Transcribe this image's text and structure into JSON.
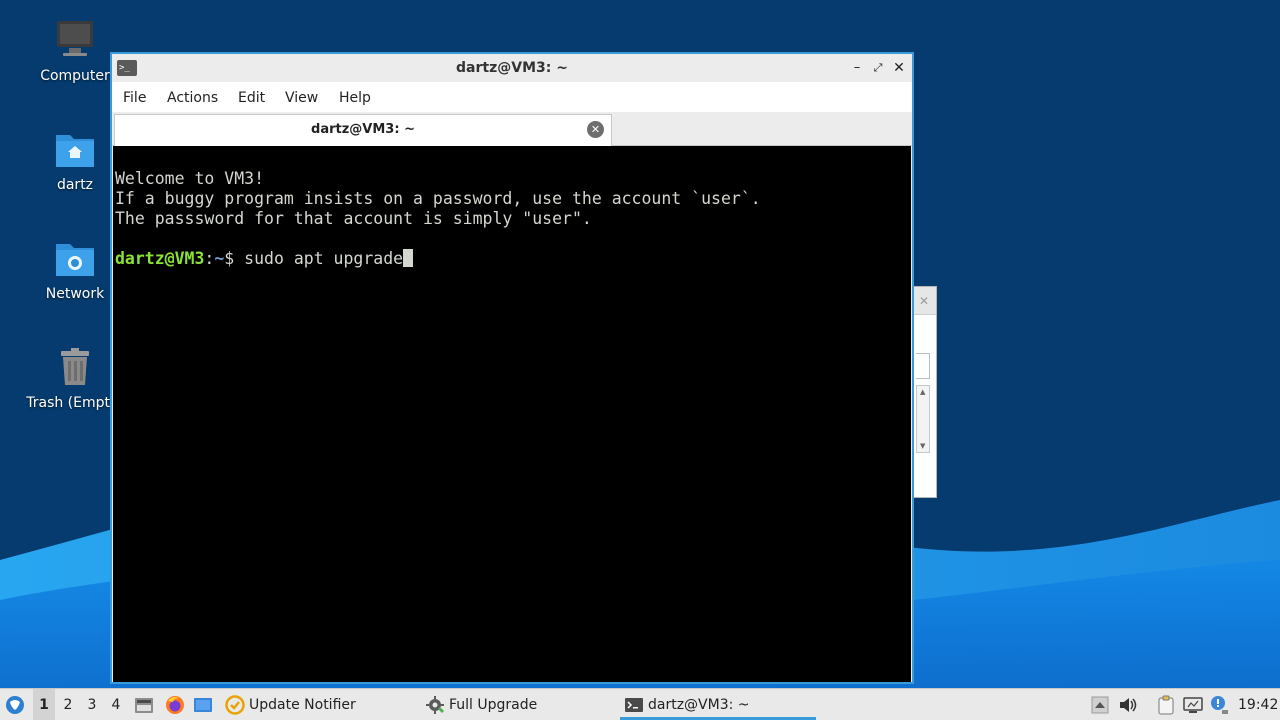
{
  "desktop": {
    "icons": [
      {
        "label": "Computer",
        "icon": "computer-icon"
      },
      {
        "label": "dartz",
        "icon": "home-folder-icon"
      },
      {
        "label": "Network",
        "icon": "network-folder-icon"
      },
      {
        "label": "Trash (Empty)",
        "icon": "trash-icon"
      }
    ]
  },
  "window": {
    "title": "dartz@VM3: ~",
    "controls": {
      "minimize": "–",
      "maximize": "⤢",
      "close": "✕"
    },
    "menu": [
      "File",
      "Actions",
      "Edit",
      "View",
      "Help"
    ],
    "tab": {
      "label": "dartz@VM3: ~",
      "close": "✕"
    }
  },
  "terminal": {
    "lines": [
      "Welcome to VM3!",
      "If a buggy program insists on a password, use the account `user`.",
      "The passsword for that account is simply \"user\"."
    ],
    "prompt": {
      "user": "dartz@VM3",
      "separator": ":",
      "path": "~",
      "symbol": "$ "
    },
    "command": "sudo apt upgrade"
  },
  "taskbar": {
    "workspaces": [
      "1",
      "2",
      "3",
      "4"
    ],
    "active_workspace": "1",
    "tasks": [
      {
        "label": "Update Notifier",
        "icon": "update-notifier-icon"
      },
      {
        "label": "Full Upgrade",
        "icon": "gear-icon"
      },
      {
        "label": "dartz@VM3: ~",
        "icon": "terminal-icon",
        "active": true
      }
    ],
    "tray": [
      "up-arrow-icon",
      "volume-icon",
      "clipboard-icon",
      "network-icon",
      "notification-icon"
    ],
    "clock": "19:42"
  },
  "colors": {
    "accent": "#3a9bd9",
    "prompt_user": "#8ae234",
    "prompt_path": "#729fcf",
    "terminal_bg": "#000000",
    "terminal_fg": "#d3d7cf"
  }
}
